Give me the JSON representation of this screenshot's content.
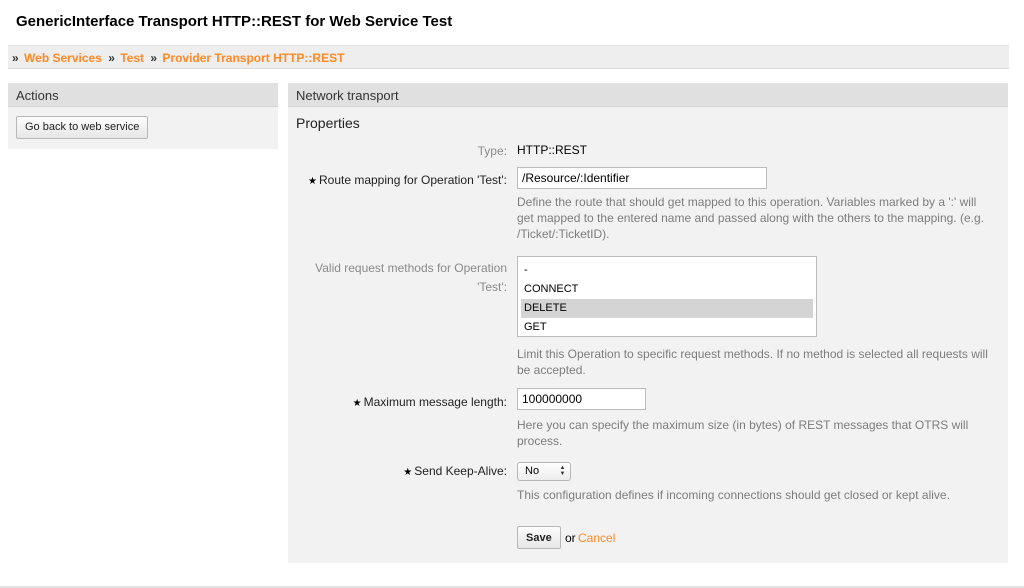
{
  "page": {
    "title": "GenericInterface Transport HTTP::REST for Web Service Test"
  },
  "breadcrumb": {
    "separator": "»",
    "items": [
      "Web Services",
      "Test",
      "Provider Transport HTTP::REST"
    ]
  },
  "sidebar": {
    "header": "Actions",
    "back_button": "Go back to web service"
  },
  "main": {
    "header": "Network transport",
    "section_title": "Properties",
    "type_label": "Type:",
    "type_value": "HTTP::REST",
    "route_label": "Route mapping for Operation 'Test':",
    "route_value": "/Resource/:Identifier",
    "route_help_lines": [
      "Define the route that should get mapped to this operation. Variables marked by a ':' will",
      "get mapped to the entered name and passed along with the others to the mapping. (e.g.",
      "/Ticket/:TicketID)."
    ],
    "methods_label_lines": [
      "Valid request methods for Operation",
      "'Test':"
    ],
    "methods_options": [
      "-",
      "CONNECT",
      "DELETE",
      "GET"
    ],
    "methods_selected": "DELETE",
    "methods_help_lines": [
      "Limit this Operation to specific request methods. If no method is selected all requests will",
      "be accepted."
    ],
    "maxlen_label": "Maximum message length:",
    "maxlen_value": "100000000",
    "maxlen_help_lines": [
      "Here you can specify the maximum size (in bytes) of REST messages that OTRS will",
      "process."
    ],
    "keepalive_label": "Send Keep-Alive:",
    "keepalive_value": "No",
    "keepalive_help": "This configuration defines if incoming connections should get closed or kept alive.",
    "save_button": "Save",
    "or_text": "or",
    "cancel_link": "Cancel",
    "required_marker": "★"
  },
  "colors": {
    "link": "#ff8a25",
    "panel": "#f2f2f2",
    "header": "#e0e0e0"
  }
}
